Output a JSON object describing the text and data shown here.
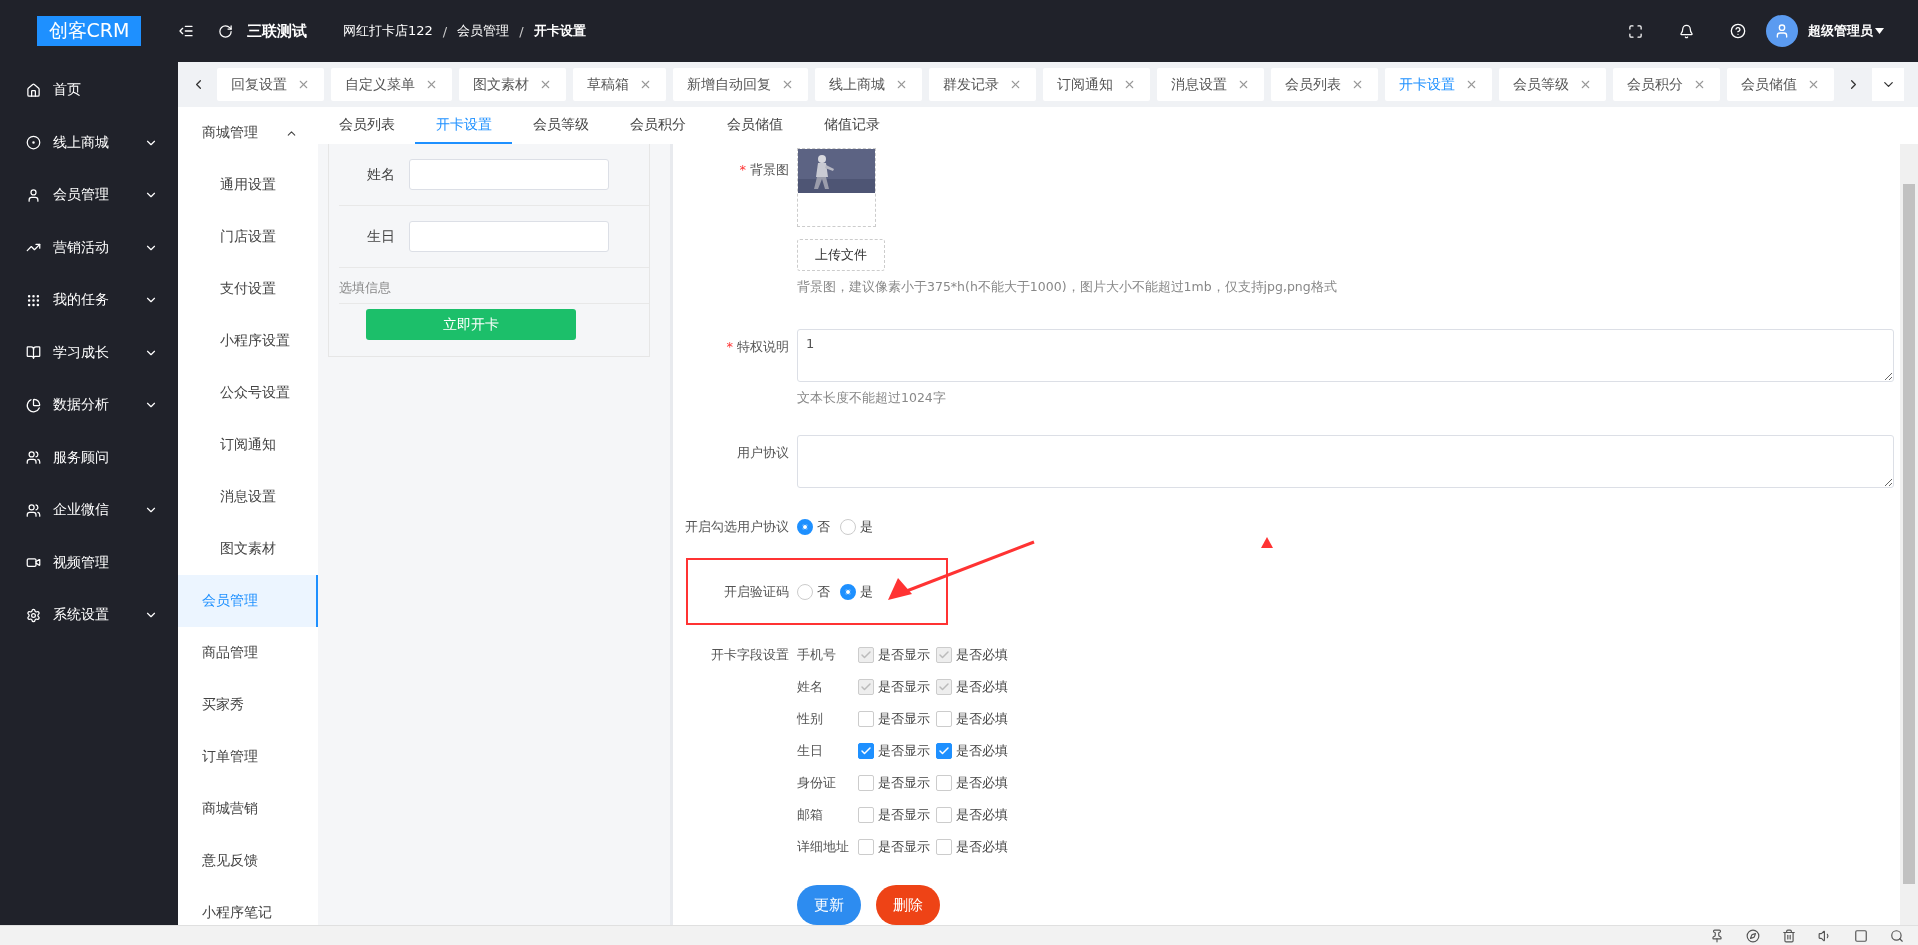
{
  "header": {
    "logo": "创客CRM",
    "app_name": "三联测试",
    "breadcrumb": [
      {
        "text": "网红打卡店122",
        "kind": "link"
      },
      {
        "text": "/",
        "kind": "separator"
      },
      {
        "text": "会员管理",
        "kind": "link"
      },
      {
        "text": "/",
        "kind": "separator"
      },
      {
        "text": "开卡设置",
        "kind": "current"
      }
    ],
    "user": "超级管理员"
  },
  "sidebar": {
    "items": [
      {
        "label": "首页",
        "kind": "link"
      },
      {
        "label": "线上商城",
        "kind": "group"
      },
      {
        "label": "会员管理",
        "kind": "group"
      },
      {
        "label": "营销活动",
        "kind": "group"
      },
      {
        "label": "我的任务",
        "kind": "group"
      },
      {
        "label": "学习成长",
        "kind": "group"
      },
      {
        "label": "数据分析",
        "kind": "group"
      },
      {
        "label": "服务顾问",
        "kind": "link"
      },
      {
        "label": "企业微信",
        "kind": "group"
      },
      {
        "label": "视频管理",
        "kind": "link"
      },
      {
        "label": "系统设置",
        "kind": "group"
      }
    ]
  },
  "tabs": [
    {
      "label": "回复设置",
      "selected": false
    },
    {
      "label": "自定义菜单",
      "selected": false
    },
    {
      "label": "图文素材",
      "selected": false
    },
    {
      "label": "草稿箱",
      "selected": false
    },
    {
      "label": "新增自动回复",
      "selected": false
    },
    {
      "label": "线上商城",
      "selected": false
    },
    {
      "label": "群发记录",
      "selected": false
    },
    {
      "label": "订阅通知",
      "selected": false
    },
    {
      "label": "消息设置",
      "selected": false
    },
    {
      "label": "会员列表",
      "selected": false
    },
    {
      "label": "开卡设置",
      "selected": true
    },
    {
      "label": "会员等级",
      "selected": false
    },
    {
      "label": "会员积分",
      "selected": false
    },
    {
      "label": "会员储值",
      "selected": false
    }
  ],
  "subnav": [
    {
      "label": "商城管理",
      "selected": false,
      "expanded": true,
      "children": [
        {
          "label": "通用设置",
          "selected": false
        },
        {
          "label": "门店设置",
          "selected": false
        },
        {
          "label": "支付设置",
          "selected": false
        },
        {
          "label": "小程序设置",
          "selected": false
        },
        {
          "label": "公众号设置",
          "selected": false
        },
        {
          "label": "订阅通知",
          "selected": false
        },
        {
          "label": "消息设置",
          "selected": false
        },
        {
          "label": "图文素材",
          "selected": false
        }
      ]
    },
    {
      "label": "会员管理",
      "selected": true
    },
    {
      "label": "商品管理",
      "selected": false
    },
    {
      "label": "买家秀",
      "selected": false
    },
    {
      "label": "订单管理",
      "selected": false
    },
    {
      "label": "商城营销",
      "selected": false
    },
    {
      "label": "意见反馈",
      "selected": false
    },
    {
      "label": "小程序笔记",
      "selected": false
    }
  ],
  "subtabs": [
    {
      "label": "会员列表",
      "selected": false
    },
    {
      "label": "开卡设置",
      "selected": true
    },
    {
      "label": "会员等级",
      "selected": false
    },
    {
      "label": "会员积分",
      "selected": false
    },
    {
      "label": "会员储值",
      "selected": false
    },
    {
      "label": "储值记录",
      "selected": false
    }
  ],
  "preview": {
    "fields": [
      {
        "label": "姓名"
      },
      {
        "label": "生日"
      }
    ],
    "section": "选填信息",
    "button": "立即开卡"
  },
  "form": {
    "background": {
      "label": "背景图",
      "required_mark": "*",
      "upload": "上传文件",
      "hint": "背景图，建议像素小于375*h(h不能大于1000)，图片大小不能超过1mb，仅支持jpg,png格式"
    },
    "privilege": {
      "label": "特权说明",
      "required_mark": "*",
      "value": "1",
      "hint": "文本长度不能超过1024字"
    },
    "agreement": {
      "label": "用户协议"
    },
    "radios": [
      {
        "label": "开启勾选用户协议",
        "highlighted": false,
        "options": [
          {
            "label": "否",
            "selected": true
          },
          {
            "label": "是",
            "selected": false
          }
        ]
      },
      {
        "label": "开启验证码",
        "highlighted": true,
        "options": [
          {
            "label": "否",
            "selected": false
          },
          {
            "label": "是",
            "selected": true
          }
        ]
      }
    ],
    "fields_label": "开卡字段设置",
    "fields": [
      {
        "name": "手机号",
        "show": {
          "label": "是否显示",
          "checked": true,
          "disabled": true
        },
        "required": {
          "label": "是否必填",
          "checked": true,
          "disabled": true
        }
      },
      {
        "name": "姓名",
        "show": {
          "label": "是否显示",
          "checked": true,
          "disabled": true
        },
        "required": {
          "label": "是否必填",
          "checked": true,
          "disabled": true
        }
      },
      {
        "name": "性别",
        "show": {
          "label": "是否显示",
          "checked": false,
          "disabled": false
        },
        "required": {
          "label": "是否必填",
          "checked": false,
          "disabled": false
        }
      },
      {
        "name": "生日",
        "show": {
          "label": "是否显示",
          "checked": true,
          "disabled": false
        },
        "required": {
          "label": "是否必填",
          "checked": true,
          "disabled": false
        }
      },
      {
        "name": "身份证",
        "show": {
          "label": "是否显示",
          "checked": false,
          "disabled": false
        },
        "required": {
          "label": "是否必填",
          "checked": false,
          "disabled": false
        }
      },
      {
        "name": "邮箱",
        "show": {
          "label": "是否显示",
          "checked": false,
          "disabled": false
        },
        "required": {
          "label": "是否必填",
          "checked": false,
          "disabled": false
        }
      },
      {
        "name": "详细地址",
        "show": {
          "label": "是否显示",
          "checked": false,
          "disabled": false
        },
        "required": {
          "label": "是否必填",
          "checked": false,
          "disabled": false
        }
      }
    ],
    "buttons": [
      {
        "label": "更新",
        "kind": "primary"
      },
      {
        "label": "删除",
        "kind": "danger"
      }
    ]
  }
}
